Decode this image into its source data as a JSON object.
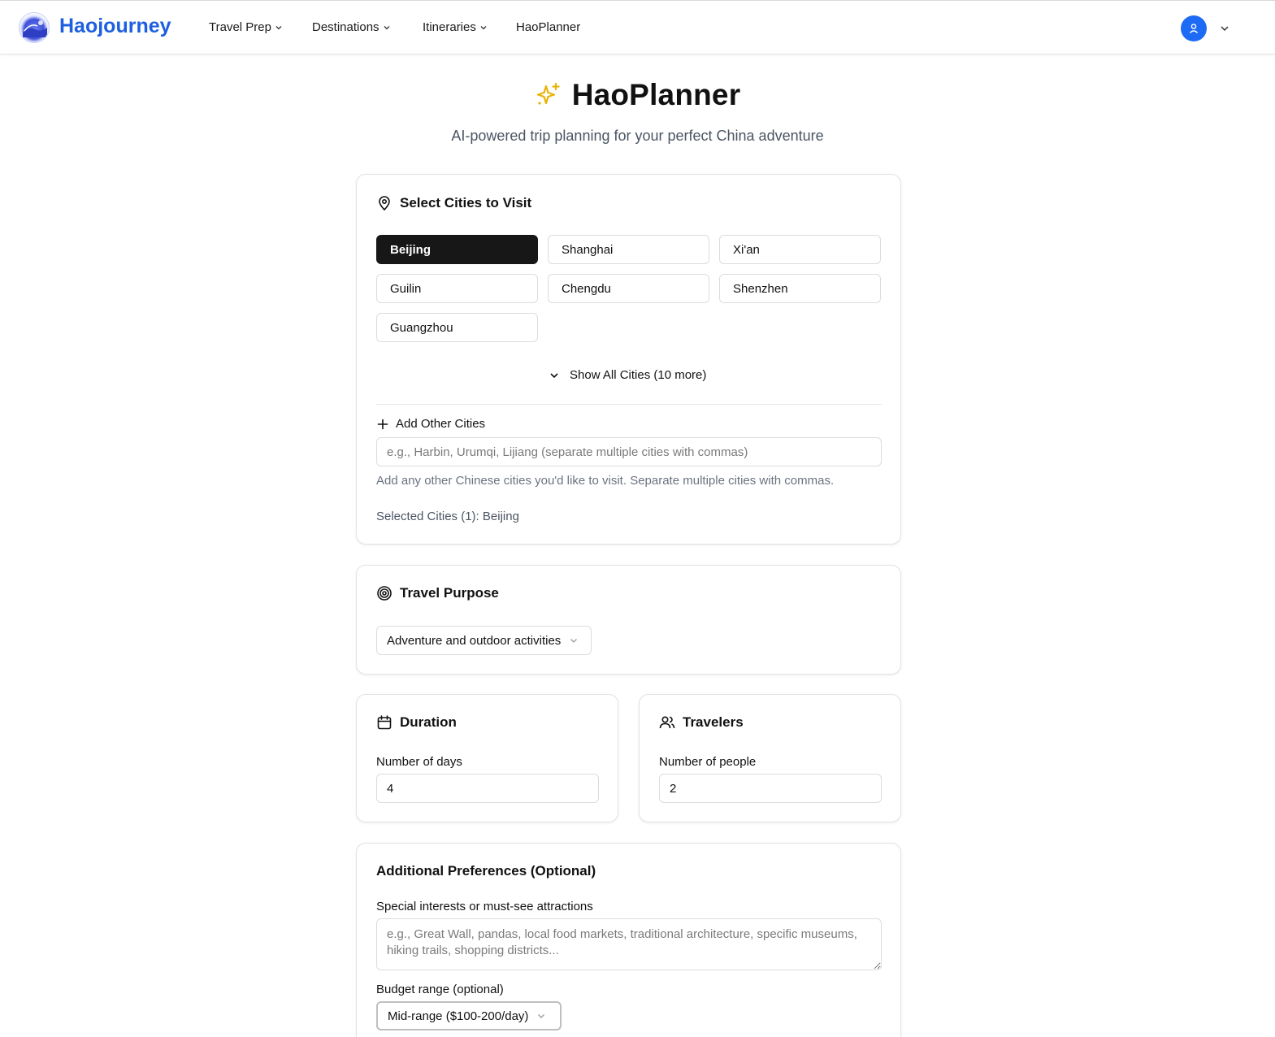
{
  "nav": {
    "brand": "Haojourney",
    "items": [
      {
        "label": "Travel Prep"
      },
      {
        "label": "Destinations"
      },
      {
        "label": "Itineraries"
      },
      {
        "label": "HaoPlanner"
      }
    ]
  },
  "header": {
    "title": "HaoPlanner",
    "subtitle": "AI-powered trip planning for your perfect China adventure",
    "icon": "sparkles-icon",
    "icon_color": "#eab308"
  },
  "cities": {
    "title": "Select Cities to Visit",
    "options": [
      {
        "label": "Beijing",
        "selected": true
      },
      {
        "label": "Shanghai",
        "selected": false
      },
      {
        "label": "Xi'an",
        "selected": false
      },
      {
        "label": "Guilin",
        "selected": false
      },
      {
        "label": "Chengdu",
        "selected": false
      },
      {
        "label": "Shenzhen",
        "selected": false
      },
      {
        "label": "Guangzhou",
        "selected": false
      }
    ],
    "show_all_label": "Show All Cities (10 more)",
    "add_other_label": "Add Other Cities",
    "add_other_placeholder": "e.g., Harbin, Urumqi, Lijiang (separate multiple cities with commas)",
    "add_other_value": "",
    "hint": "Add any other Chinese cities you'd like to visit. Separate multiple cities with commas.",
    "selected_summary": "Selected Cities (1): Beijing"
  },
  "purpose": {
    "title": "Travel Purpose",
    "selected": "Adventure and outdoor activities"
  },
  "duration": {
    "title": "Duration",
    "label": "Number of days",
    "value": "4"
  },
  "travelers": {
    "title": "Travelers",
    "label": "Number of people",
    "value": "2"
  },
  "preferences": {
    "title": "Additional Preferences (Optional)",
    "interests_label": "Special interests or must-see attractions",
    "interests_placeholder": "e.g., Great Wall, pandas, local food markets, traditional architecture, specific museums, hiking trails, shopping districts...",
    "budget_label": "Budget range (optional)",
    "budget_selected": "Mid-range ($100-200/day)"
  },
  "colors": {
    "brand": "#1d5fe0",
    "avatar": "#1d6af5",
    "selected_chip": "#171717"
  }
}
